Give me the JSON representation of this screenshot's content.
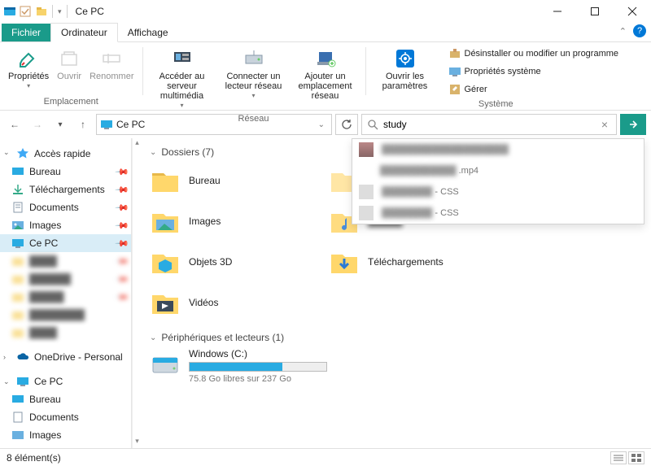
{
  "window": {
    "title": "Ce PC"
  },
  "tabs": {
    "file": "Fichier",
    "computer": "Ordinateur",
    "view": "Affichage"
  },
  "ribbon": {
    "location": {
      "label": "Emplacement",
      "properties": "Propriétés",
      "open": "Ouvrir",
      "rename": "Renommer"
    },
    "network": {
      "label": "Réseau",
      "media_server": "Accéder au serveur multimédia",
      "connect_drive": "Connecter un lecteur réseau",
      "add_location": "Ajouter un emplacement réseau"
    },
    "system": {
      "label": "Système",
      "open_settings": "Ouvrir les paramètres",
      "uninstall": "Désinstaller ou modifier un programme",
      "sys_props": "Propriétés système",
      "manage": "Gérer"
    }
  },
  "address": {
    "text": "Ce PC"
  },
  "search": {
    "value": "study",
    "suggestions": [
      {
        "ext": ".mp4"
      },
      {
        "ext": "- CSS"
      },
      {
        "ext": "- CSS"
      }
    ]
  },
  "sidebar": {
    "quick_access": "Accès rapide",
    "desktop": "Bureau",
    "downloads": "Téléchargements",
    "documents": "Documents",
    "images": "Images",
    "this_pc": "Ce PC",
    "onedrive": "OneDrive - Personal",
    "this_pc2": "Ce PC",
    "desktop2": "Bureau",
    "documents2": "Documents",
    "images2": "Images"
  },
  "main": {
    "folders_header": "Dossiers (7)",
    "drives_header": "Périphériques et lecteurs (1)",
    "folders": {
      "desktop": "Bureau",
      "images": "Images",
      "objects3d": "Objets 3D",
      "videos": "Vidéos",
      "downloads": "Téléchargements"
    },
    "drive": {
      "name": "Windows  (C:)",
      "free_text": "75.8 Go libres sur 237 Go",
      "fill_pct": 68
    }
  },
  "status": {
    "items": "8 élément(s)"
  }
}
